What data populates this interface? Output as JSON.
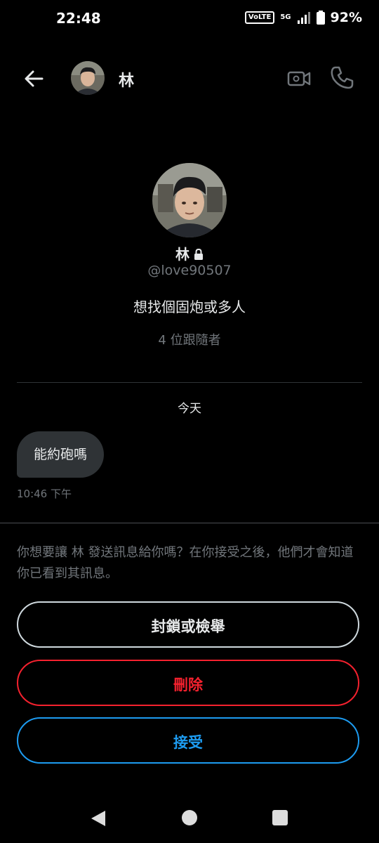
{
  "status_bar": {
    "time": "22:48",
    "volte": "VoLTE",
    "network": "5G",
    "battery": "92%"
  },
  "header": {
    "name": "林",
    "icons": [
      "back-arrow-icon",
      "video-call-icon",
      "phone-icon"
    ]
  },
  "profile": {
    "name": "林",
    "handle": "@love90507",
    "bio": "想找個固炮或多人",
    "followers": "4 位跟隨者"
  },
  "conversation": {
    "day_label": "今天",
    "messages": [
      {
        "text": "能約砲嗎",
        "time": "10:46 下午"
      }
    ]
  },
  "request": {
    "prompt": "你想要讓 林 發送訊息給你嗎？在你接受之後，他們才會知道你已看到其訊息。",
    "block_label": "封鎖或檢舉",
    "delete_label": "刪除",
    "accept_label": "接受"
  },
  "colors": {
    "background": "#000000",
    "accent_blue": "#1d9bf0",
    "danger_red": "#f4212e",
    "muted_text": "#71767b",
    "bubble": "#2f3336"
  }
}
